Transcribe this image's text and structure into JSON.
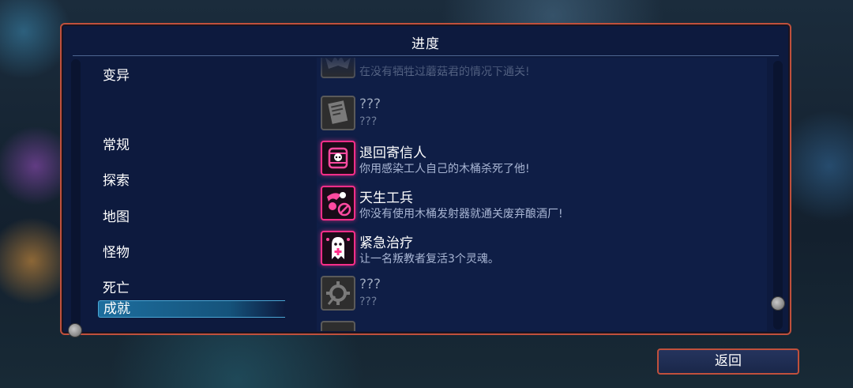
{
  "window": {
    "title": "进度"
  },
  "categories": [
    {
      "label": "变异",
      "selected": false
    },
    {
      "label": "常规",
      "selected": false
    },
    {
      "label": "探索",
      "selected": false
    },
    {
      "label": "地图",
      "selected": false
    },
    {
      "label": "怪物",
      "selected": false
    },
    {
      "label": "死亡",
      "selected": false
    },
    {
      "label": "成就",
      "selected": true
    }
  ],
  "achievements": [
    {
      "name": "",
      "desc": "在没有牺牲过蘑菇君的情况下通关!",
      "locked": true,
      "icon": "bat-icon"
    },
    {
      "name": "???",
      "desc": "???",
      "locked": true,
      "icon": "scroll-icon"
    },
    {
      "name": "退回寄信人",
      "desc": "你用感染工人自己的木桶杀死了他!",
      "locked": false,
      "icon": "skull-barrel-icon"
    },
    {
      "name": "天生工兵",
      "desc": "你没有使用木桶发射器就通关废弃酿酒厂!",
      "locked": false,
      "icon": "no-barrel-icon"
    },
    {
      "name": "紧急治疗",
      "desc": "让一名叛教者复活3个灵魂。",
      "locked": false,
      "icon": "ghost-heal-icon"
    },
    {
      "name": "???",
      "desc": "???",
      "locked": true,
      "icon": "gear-icon"
    }
  ],
  "buttons": {
    "back": "返回"
  },
  "colors": {
    "panel_border": "#c0503c",
    "panel_bg": "#0d1a3e",
    "unlocked_accent": "#ff2e8a",
    "selected_bg": "#1d6e9e"
  }
}
